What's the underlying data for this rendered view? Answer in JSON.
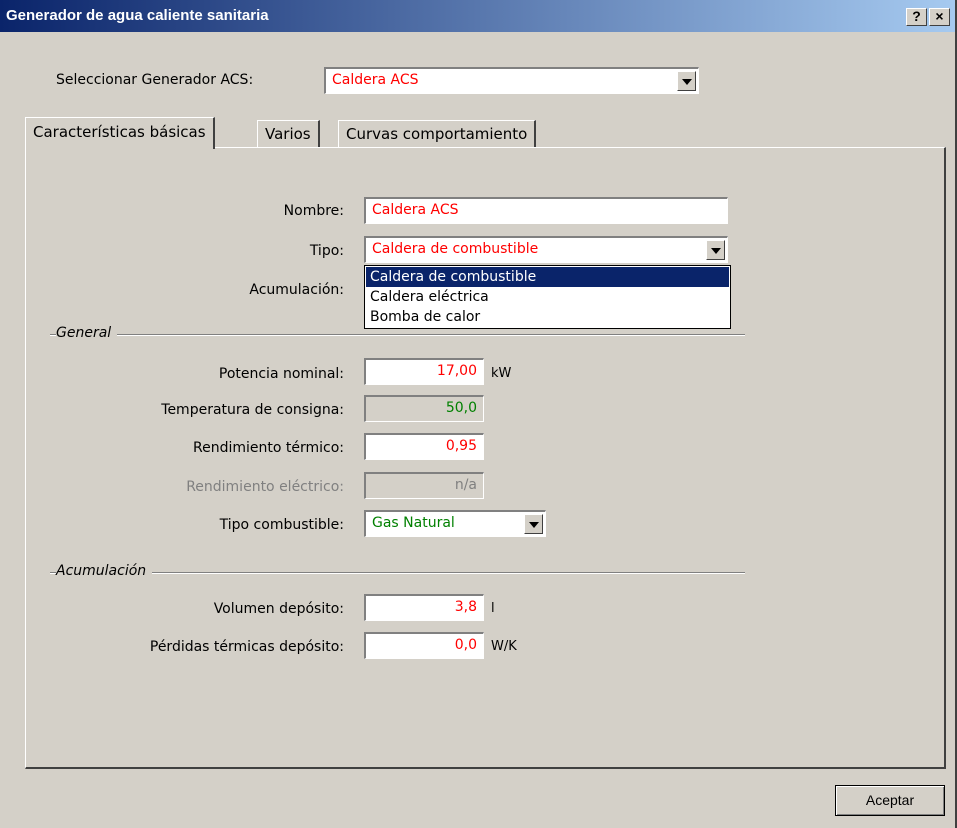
{
  "window": {
    "title": "Generador de agua caliente sanitaria",
    "help_label": "?",
    "close_label": "×"
  },
  "selector": {
    "label": "Seleccionar Generador ACS:",
    "value": "Caldera ACS"
  },
  "tabs": [
    {
      "label": "Características básicas",
      "active": true
    },
    {
      "label": "Varios",
      "active": false
    },
    {
      "label": "Curvas comportamiento",
      "active": false
    }
  ],
  "basic": {
    "nombre_label": "Nombre:",
    "nombre_value": "Caldera ACS",
    "tipo_label": "Tipo:",
    "tipo_value": "Caldera de combustible",
    "acumulacion_label": "Acumulación:"
  },
  "tipo_options": [
    {
      "label": "Caldera de combustible",
      "selected": true
    },
    {
      "label": "Caldera eléctrica",
      "selected": false
    },
    {
      "label": "Bomba de calor",
      "selected": false
    }
  ],
  "general": {
    "title": "General",
    "potencia_label": "Potencia nominal:",
    "potencia_value": "17,00",
    "potencia_unit": "kW",
    "temp_label": "Temperatura de consigna:",
    "temp_value": "50,0",
    "rend_termico_label": "Rendimiento térmico:",
    "rend_termico_value": "0,95",
    "rend_electrico_label": "Rendimiento eléctrico:",
    "rend_electrico_value": "n/a",
    "combustible_label": "Tipo combustible:",
    "combustible_value": "Gas Natural"
  },
  "acumulacion": {
    "title": "Acumulación",
    "volumen_label": "Volumen depósito:",
    "volumen_value": "3,8",
    "volumen_unit": "l",
    "perdidas_label": "Pérdidas térmicas depósito:",
    "perdidas_value": "0,0",
    "perdidas_unit": "W/K"
  },
  "footer": {
    "ok_label": "Aceptar"
  },
  "colors": {
    "titlebar_start": "#0a246a",
    "titlebar_end": "#a6caf0",
    "value_red": "#ff0000",
    "value_green": "#008000",
    "selection": "#0a246a"
  }
}
